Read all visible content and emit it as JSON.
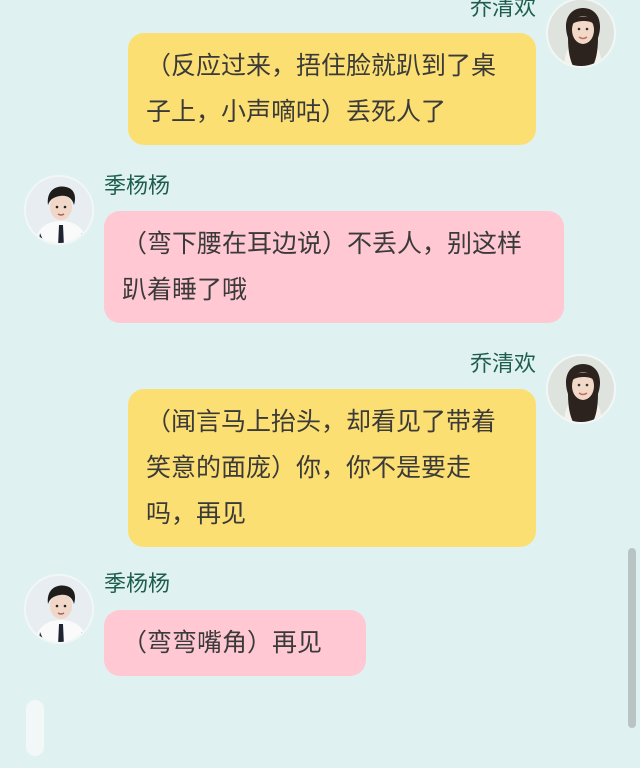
{
  "messages": [
    {
      "sender": "乔清欢",
      "text": "（反应过来，捂住脸就趴到了桌子上，小声嘀咕）丢死人了"
    },
    {
      "sender": "季杨杨",
      "text": "（弯下腰在耳边说）不丢人，别这样趴着睡了哦"
    },
    {
      "sender": "乔清欢",
      "text": "（闻言马上抬头，却看见了带着笑意的面庞）你，你不是要走吗，再见"
    },
    {
      "sender": "季杨杨",
      "text": "（弯弯嘴角）再见"
    }
  ],
  "colors": {
    "background": "#dff2f1",
    "bubble_right": "#fcdf72",
    "bubble_left": "#ffc8d3",
    "name_text": "#1f5e4c"
  },
  "icons": {
    "avatar_right": "female-avatar",
    "avatar_left": "male-avatar"
  }
}
